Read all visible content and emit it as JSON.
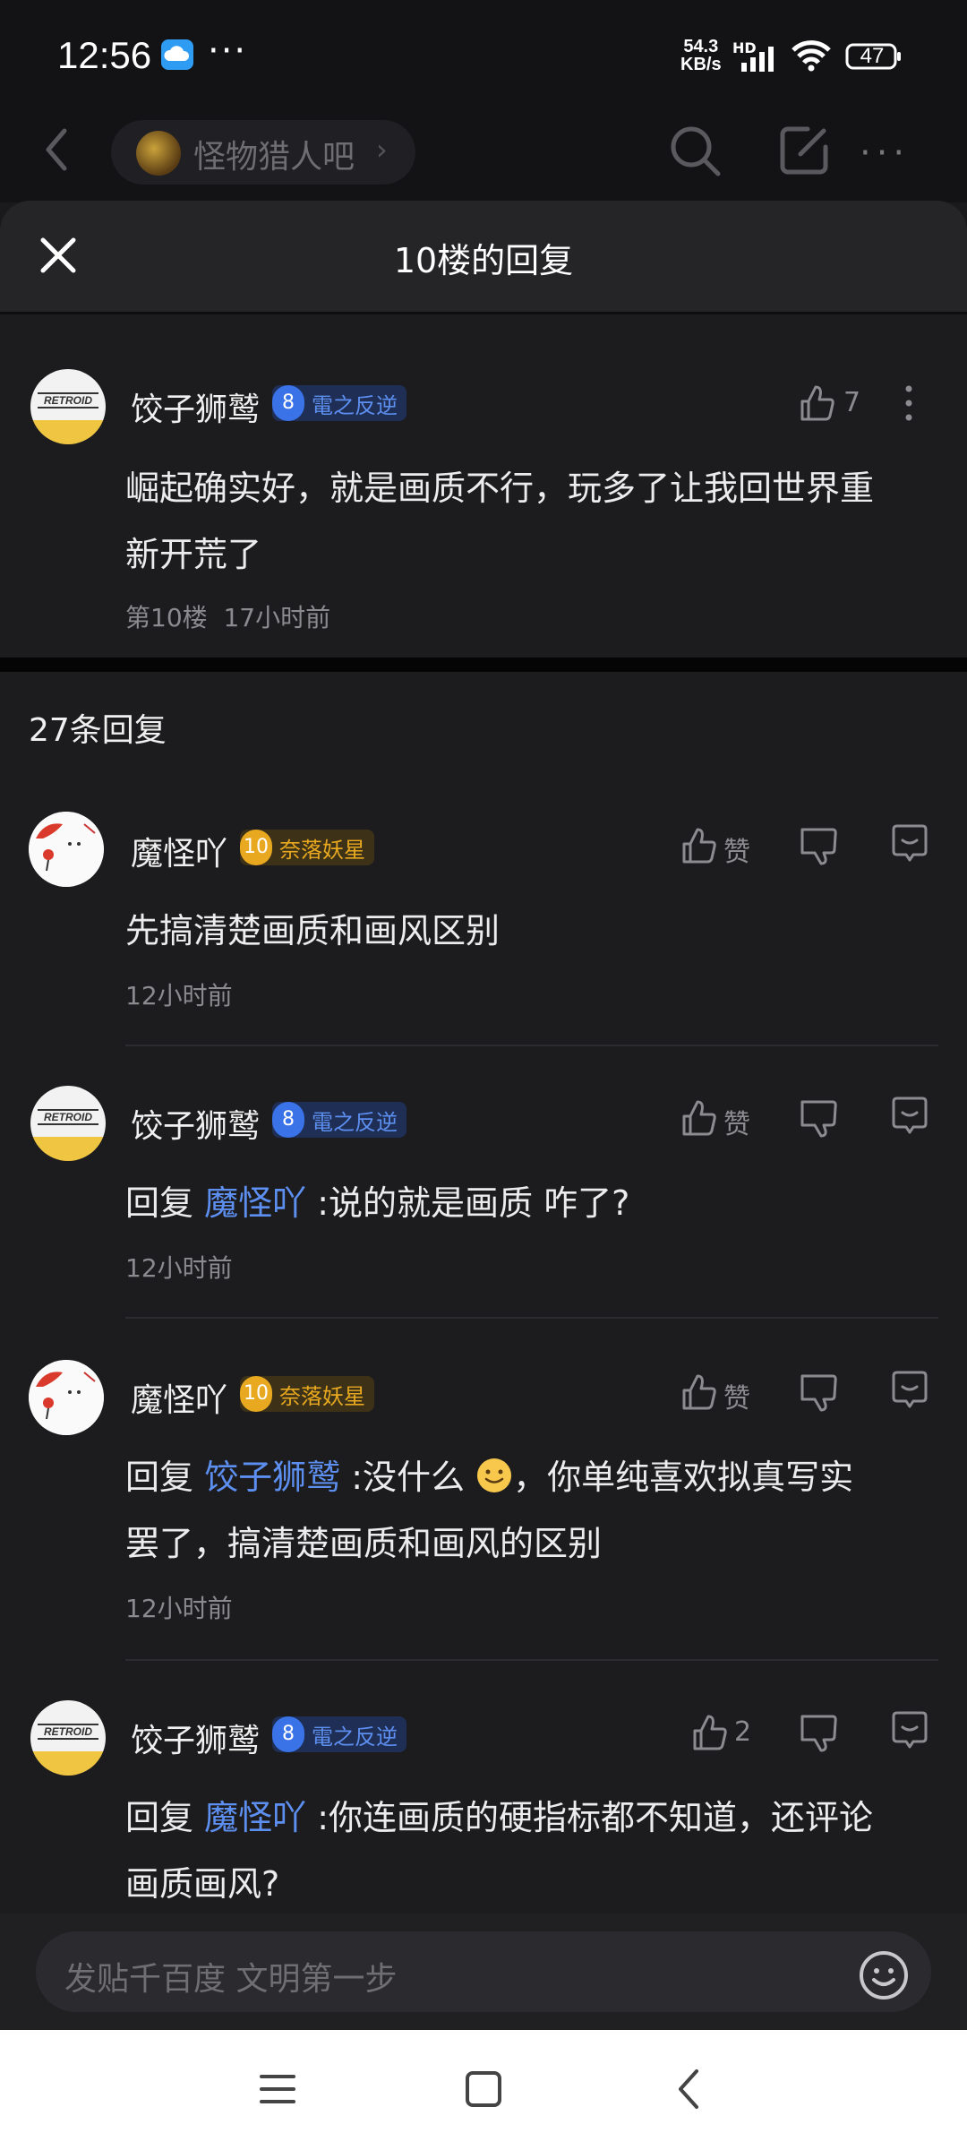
{
  "status_bar": {
    "time": "12:56",
    "dots": "···",
    "net_speed_value": "54.3",
    "net_speed_unit": "KB/s",
    "hd": "HD",
    "battery": "47"
  },
  "topnav": {
    "forum_name": "怪物猎人吧",
    "chevron": "›"
  },
  "sheet": {
    "title": "10楼的回复"
  },
  "main_post": {
    "username": "饺子狮鹫",
    "level_num": "8",
    "level_name": "電之反逆",
    "like_count": "7",
    "text_line1": "崛起确实好，就是画质不行，玩多了让我回世界重",
    "text_line2": "新开荒了",
    "floor": "第10楼",
    "time": "17小时前"
  },
  "reply_count": "27条回复",
  "replies": [
    {
      "username": "魔怪吖",
      "level_num": "10",
      "level_name": "奈落妖星",
      "like_label": "赞",
      "text": "先搞清楚画质和画风区别",
      "time": "12小时前"
    },
    {
      "username": "饺子狮鹫",
      "level_num": "8",
      "level_name": "電之反逆",
      "like_label": "赞",
      "reply_prefix": "回复",
      "mention": "魔怪吖",
      "text": ":说的就是画质 咋了?",
      "time": "12小时前"
    },
    {
      "username": "魔怪吖",
      "level_num": "10",
      "level_name": "奈落妖星",
      "like_label": "赞",
      "reply_prefix": "回复",
      "mention": "饺子狮鹫",
      "text_a": ":没什么",
      "text_b": "，你单纯喜欢拟真写实",
      "text_line2": "罢了，搞清楚画质和画风的区别",
      "time": "12小时前"
    },
    {
      "username": "饺子狮鹫",
      "level_num": "8",
      "level_name": "電之反逆",
      "like_label": "2",
      "reply_prefix": "回复",
      "mention": "魔怪吖",
      "text": ":你连画质的硬指标都不知道，还评论",
      "text_line2": "画质画风?"
    }
  ],
  "input": {
    "placeholder": "发贴千百度 文明第一步"
  },
  "avatar_logo": "RETROID",
  "colors": {
    "background": "#1c1c1e",
    "accent_blue": "#5d8ff0",
    "level_gold": "#e8a81f"
  }
}
